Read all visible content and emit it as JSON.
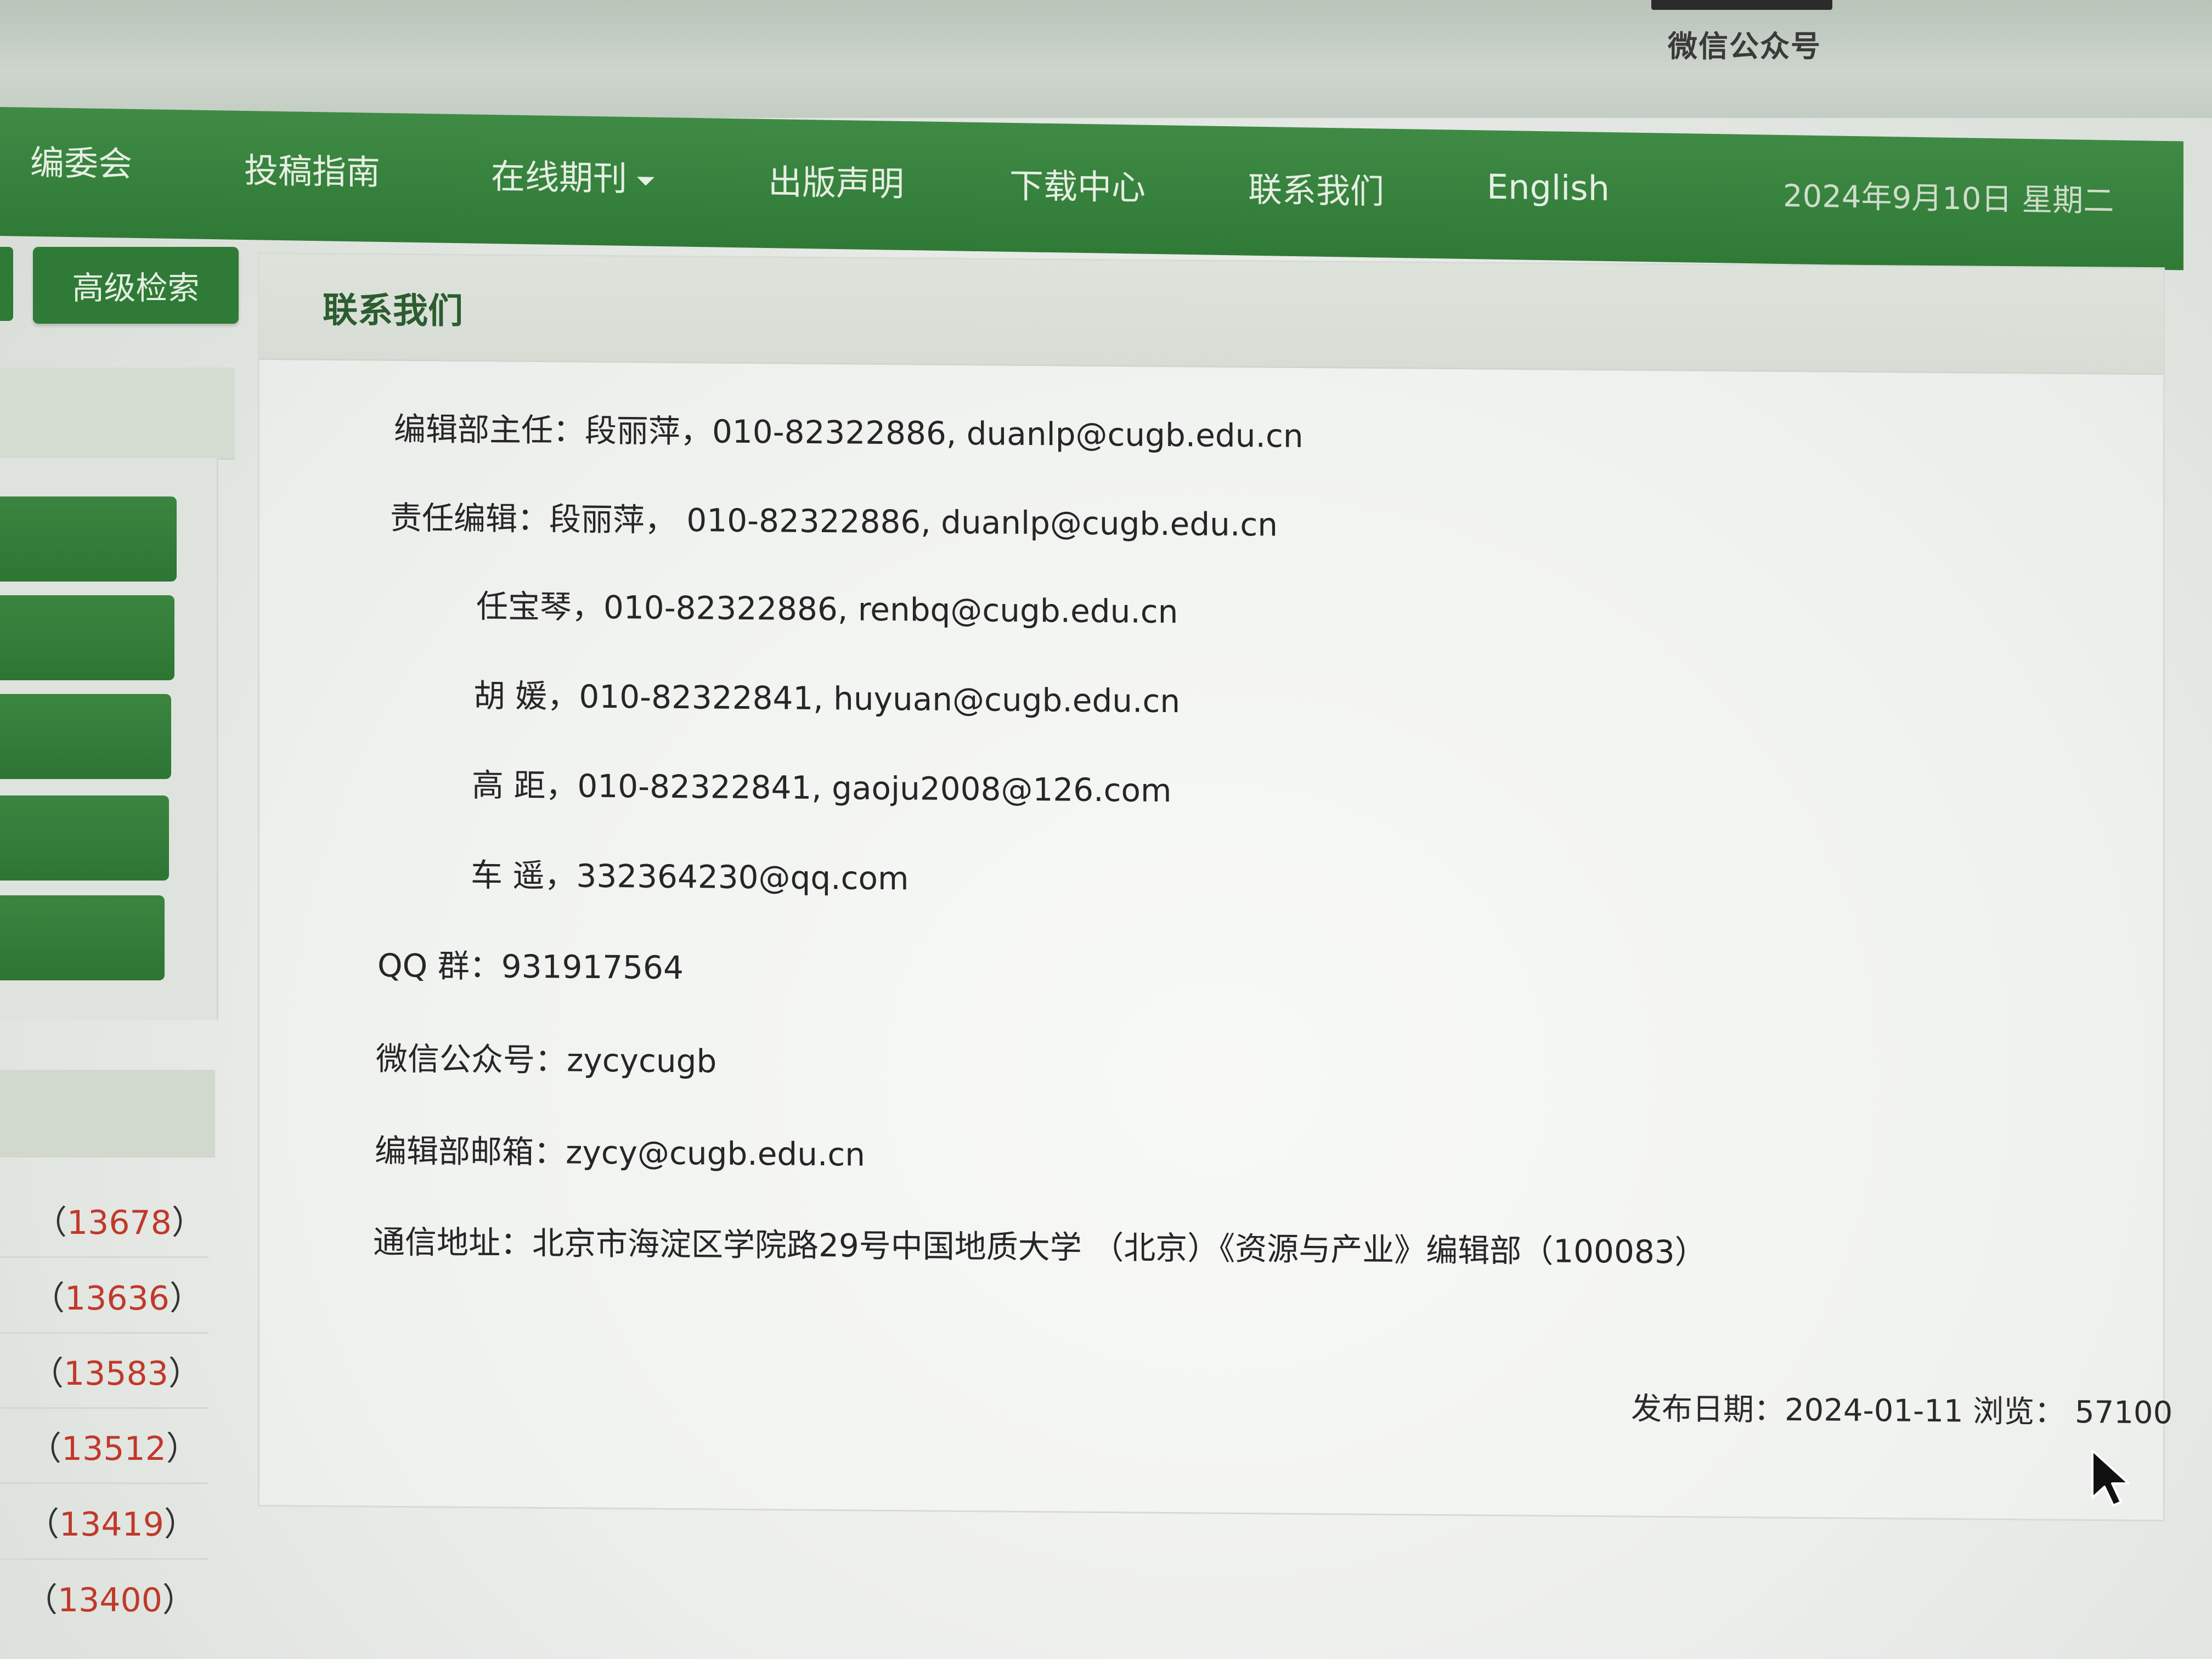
{
  "header": {
    "wechat_caption": "微信公众号"
  },
  "nav": {
    "items": [
      {
        "label": "编委会"
      },
      {
        "label": "投稿指南"
      },
      {
        "label": "在线期刊"
      },
      {
        "label": "出版声明"
      },
      {
        "label": "下载中心"
      },
      {
        "label": "联系我们"
      },
      {
        "label": "English"
      }
    ],
    "date": "2024年9月10日 星期二"
  },
  "sidebar": {
    "advanced_search_label": "高级检索",
    "counts": [
      {
        "text": "13678"
      },
      {
        "text": "13636"
      },
      {
        "text": "13583"
      },
      {
        "text": "13512"
      },
      {
        "text": "13419"
      },
      {
        "text": "13400"
      }
    ]
  },
  "content": {
    "title": "联系我们",
    "lines": [
      "编辑部主任：段丽萍，010-82322886, duanlp@cugb.edu.cn",
      "责任编辑：段丽萍， 010-82322886, duanlp@cugb.edu.cn",
      "任宝琴，010-82322886, renbq@cugb.edu.cn",
      "胡  媛，010-82322841, huyuan@cugb.edu.cn",
      "高  距，010-82322841, gaoju2008@126.com",
      "车  遥，332364230@qq.com",
      "QQ 群：931917564",
      "微信公众号：zycycugb",
      "编辑部邮箱：zycy@cugb.edu.cn",
      "通信地址：北京市海淀区学院路29号中国地质大学 （北京）《资源与产业》编辑部（100083）"
    ],
    "publish_info": "发布日期：2024-01-11 浏览： 57100"
  },
  "colors": {
    "nav_green": "#2f7a36",
    "title_green": "#2c5c2f",
    "count_red": "#c0392b"
  }
}
